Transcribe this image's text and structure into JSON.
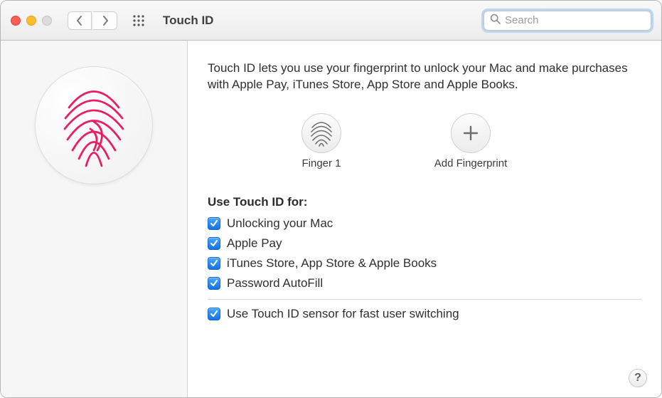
{
  "titlebar": {
    "title": "Touch ID",
    "search_placeholder": "Search"
  },
  "intro": "Touch ID lets you use your fingerprint to unlock your Mac and make purchases with Apple Pay, iTunes Store, App Store and Apple Books.",
  "fingerprints": {
    "existing_label": "Finger 1",
    "add_label": "Add Fingerprint"
  },
  "section_heading": "Use Touch ID for:",
  "options": [
    {
      "label": "Unlocking your Mac",
      "checked": true
    },
    {
      "label": "Apple Pay",
      "checked": true
    },
    {
      "label": "iTunes Store, App Store & Apple Books",
      "checked": true
    },
    {
      "label": "Password AutoFill",
      "checked": true
    }
  ],
  "fast_user_switching": {
    "label": "Use Touch ID sensor for fast user switching",
    "checked": true
  },
  "help_label": "?"
}
